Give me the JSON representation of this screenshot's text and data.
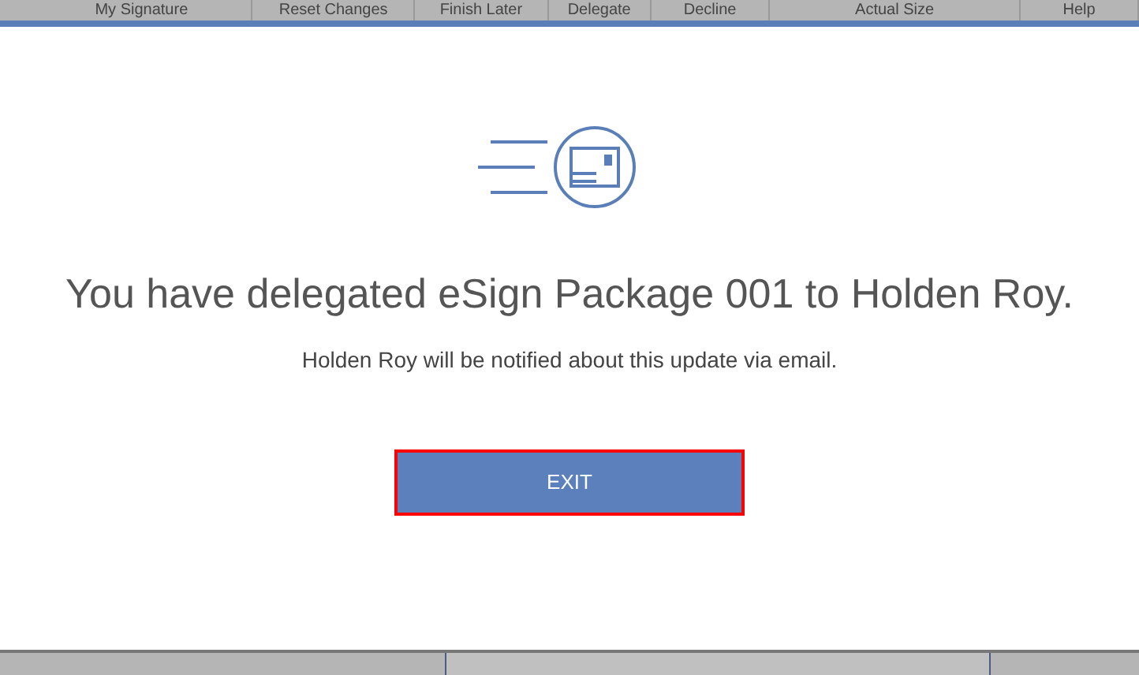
{
  "toolbar": {
    "items": [
      "My Signature",
      "Reset Changes",
      "Finish Later",
      "Delegate",
      "Decline",
      "Actual Size",
      "Help"
    ]
  },
  "dialog": {
    "heading": "You have delegated eSign Package 001 to Holden Roy.",
    "message": "Holden Roy will be notified about this update via email.",
    "button": {
      "label": "EXIT",
      "focused": true
    }
  }
}
